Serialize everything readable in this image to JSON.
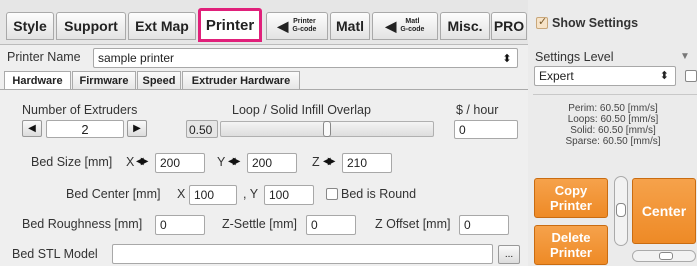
{
  "tabs": {
    "style": "Style",
    "support": "Support",
    "ext_map": "Ext Map",
    "printer": "Printer",
    "printer_gcode_top": "Printer",
    "printer_gcode_bottom": "G-code",
    "matl": "Matl",
    "matl_gcode_top": "Matl",
    "matl_gcode_bottom": "G-code",
    "misc": "Misc.",
    "pro": "PRO"
  },
  "printer_name": {
    "label": "Printer Name",
    "value": "sample printer"
  },
  "subtabs": [
    "Hardware",
    "Firmware",
    "Speed",
    "Extruder Hardware"
  ],
  "extruders": {
    "label": "Number of Extruders",
    "value": "2"
  },
  "overlap": {
    "label": "Loop / Solid Infill Overlap",
    "value": "0.50",
    "slider_level": 0.5
  },
  "cost": {
    "label": "$ / hour",
    "value": "0"
  },
  "bed_size": {
    "label": "Bed Size [mm]",
    "x_label": "X",
    "x": "200",
    "y_label": "Y",
    "y": "200",
    "z_label": "Z",
    "z": "210"
  },
  "bed_center": {
    "label": "Bed Center [mm]",
    "x_label": "X",
    "x": "100",
    "y_label": ", Y",
    "y": "100",
    "round_label": "Bed is Round"
  },
  "bed_roughness": {
    "label": "Bed Roughness [mm]",
    "value": "0"
  },
  "z_settle": {
    "label": "Z-Settle [mm]",
    "value": "0"
  },
  "z_offset": {
    "label": "Z Offset [mm]",
    "value": "0"
  },
  "bed_stl": {
    "label": "Bed STL Model",
    "value": "",
    "browse": "..."
  },
  "right": {
    "show_settings": "Show Settings",
    "settings_level_label": "Settings Level",
    "settings_level_value": "Expert",
    "speeds": [
      "Perim: 60.50 [mm/s]",
      "Loops: 60.50 [mm/s]",
      "Solid: 60.50 [mm/s]",
      "Sparse: 60.50 [mm/s]"
    ],
    "copy_top": "Copy",
    "copy_bottom": "Printer",
    "delete_top": "Delete",
    "delete_bottom": "Printer",
    "center": "Center"
  },
  "colors": {
    "accent": "#ee8a26",
    "active_tab_border": "#e0207a"
  }
}
